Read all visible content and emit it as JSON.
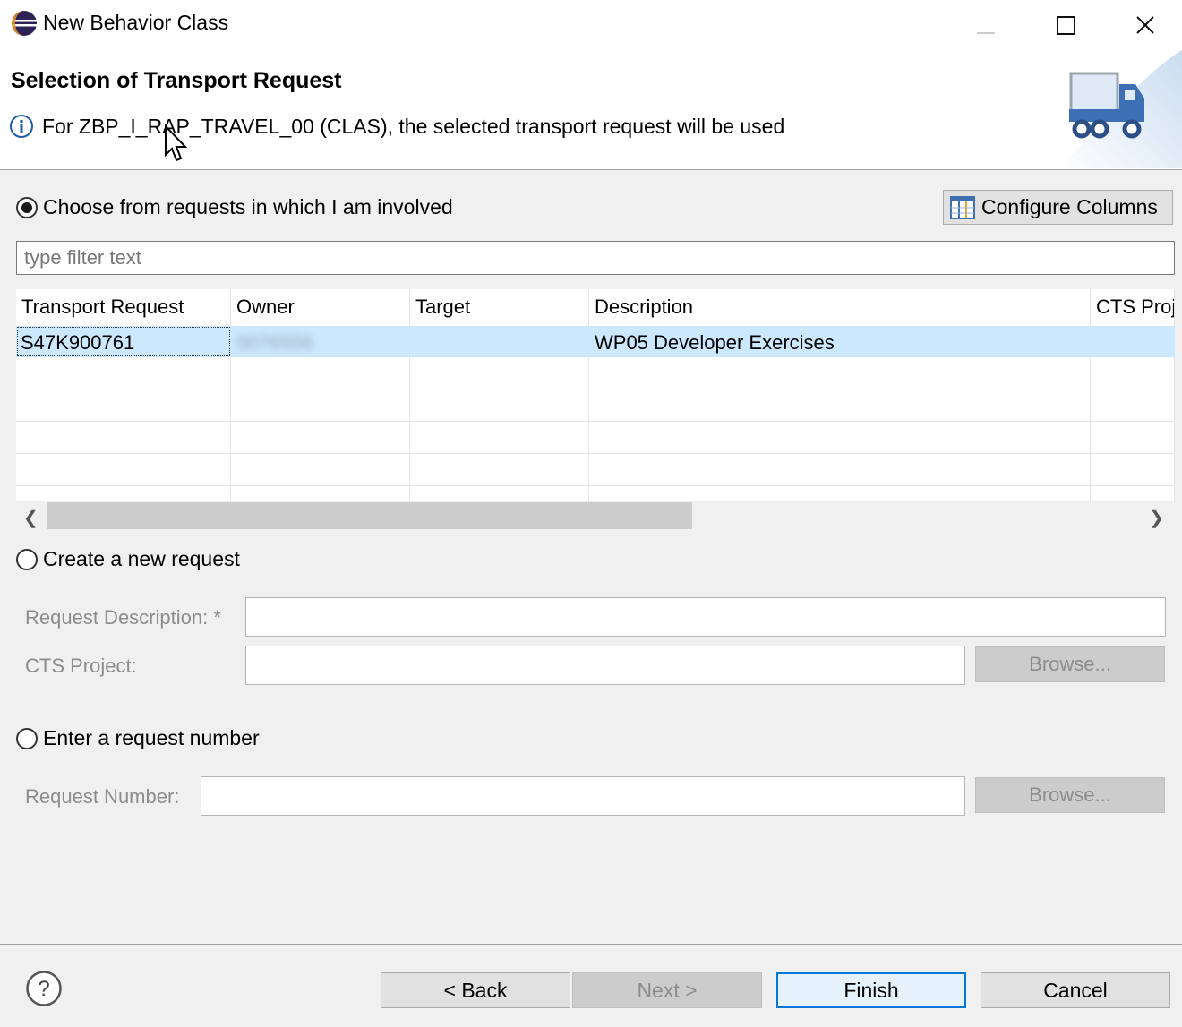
{
  "window": {
    "title": "New Behavior Class",
    "app_icon": "eclipse-icon",
    "controls": [
      "minimize-icon",
      "maximize-icon",
      "close-icon"
    ]
  },
  "banner": {
    "title": "Selection of Transport Request",
    "message": "For ZBP_I_RAP_TRAVEL_00 (CLAS), the selected transport request will be used",
    "info_icon": "info-icon",
    "graphic": "transport-truck-icon"
  },
  "choose_section": {
    "radio_label": "Choose from requests in which I am involved",
    "selected": true,
    "configure_button": "Configure Columns",
    "filter_placeholder": "type filter text"
  },
  "table": {
    "columns": [
      "Transport Request",
      "Owner",
      "Target",
      "Description",
      "CTS Proj"
    ],
    "rows": [
      {
        "transport_request": "S47K900761",
        "owner": "0076556",
        "target": "",
        "description": "WP05 Developer Exercises",
        "cts_project": ""
      }
    ],
    "selected_row": 0
  },
  "create_section": {
    "radio_label": "Create a new request",
    "selected": false,
    "description_label": "Request Description: *",
    "description_value": "",
    "cts_label": "CTS Project:",
    "cts_value": "",
    "browse_label": "Browse..."
  },
  "enter_section": {
    "radio_label": "Enter a request number",
    "selected": false,
    "number_label": "Request Number:",
    "number_value": "",
    "browse_label": "Browse..."
  },
  "footer": {
    "help_icon": "help-icon",
    "back": "< Back",
    "next": "Next >",
    "finish": "Finish",
    "cancel": "Cancel"
  }
}
